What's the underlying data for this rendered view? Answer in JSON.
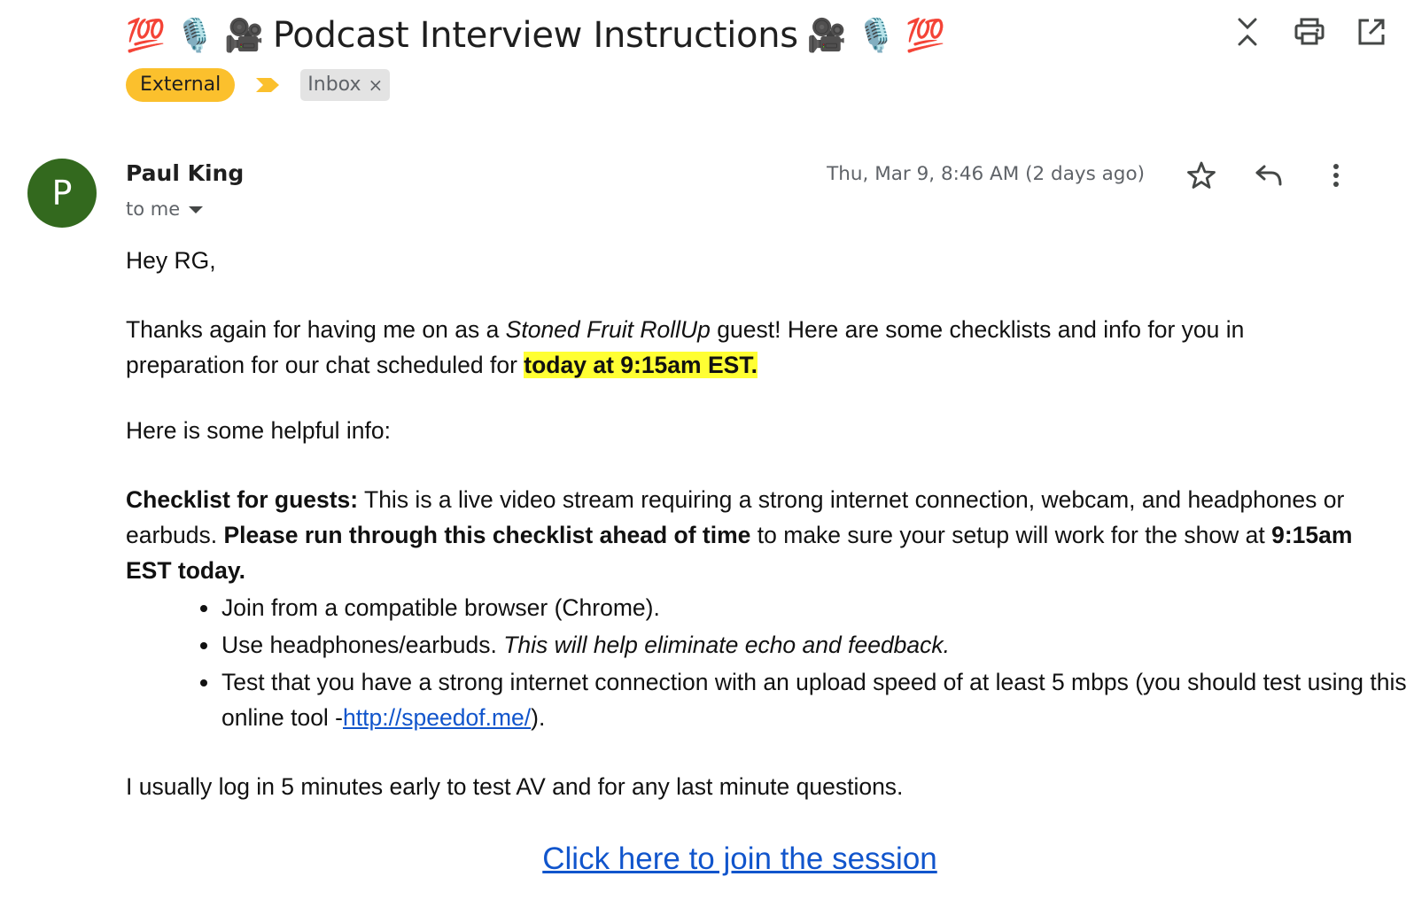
{
  "header": {
    "subject_prefix_emoji": "💯 🎙️ 🎥",
    "subject_text": "Podcast Interview Instructions",
    "subject_suffix_emoji": "🎥 🎙️ 💯",
    "icons": [
      "collapse-icon",
      "print-icon",
      "open-in-new-icon"
    ]
  },
  "labels": {
    "external": "External",
    "inbox": "Inbox",
    "inbox_remove": "×"
  },
  "message": {
    "avatar_letter": "P",
    "avatar_color": "#33691e",
    "sender": "Paul King",
    "recipient": "to me",
    "date": "Thu, Mar 9, 8:46 AM (2 days ago)",
    "icons": [
      "star-icon",
      "reply-icon",
      "more-vert-icon"
    ]
  },
  "body": {
    "greeting": "Hey RG,",
    "intro_1": "Thanks again for having me on as a ",
    "intro_show": "Stoned Fruit RollUp",
    "intro_2": " guest! Here are some checklists and info for you in preparation for our chat scheduled for ",
    "intro_highlight": "today at 9:15am EST.",
    "helpful": "Here is some helpful info:",
    "checklist_heading": "Checklist for guests:",
    "checklist_1": " This is a live video stream requiring a strong internet connection, webcam, and headphones or earbuds. ",
    "checklist_bold": "Please run through this checklist ahead of time",
    "checklist_2": " to make sure your setup will work for the show at ",
    "checklist_time": "9:15am EST today.",
    "bullet_1": "Join from a compatible browser (Chrome).",
    "bullet_2_plain": "Use headphones/earbuds. ",
    "bullet_2_italic": "This will help eliminate echo and feedback.",
    "bullet_3_plain": "Test that you have a strong internet connection with an upload speed of at least 5 mbps (you should test using this online tool -",
    "bullet_3_link": "http://speedof.me/",
    "bullet_3_end": ").",
    "closing": "I usually log in 5 minutes early to test AV and for any last minute questions.",
    "join_link": "Click here to join the session"
  },
  "colors": {
    "external_label": "#fbc02d",
    "highlight": "#ffff33",
    "link": "#1155cc"
  }
}
